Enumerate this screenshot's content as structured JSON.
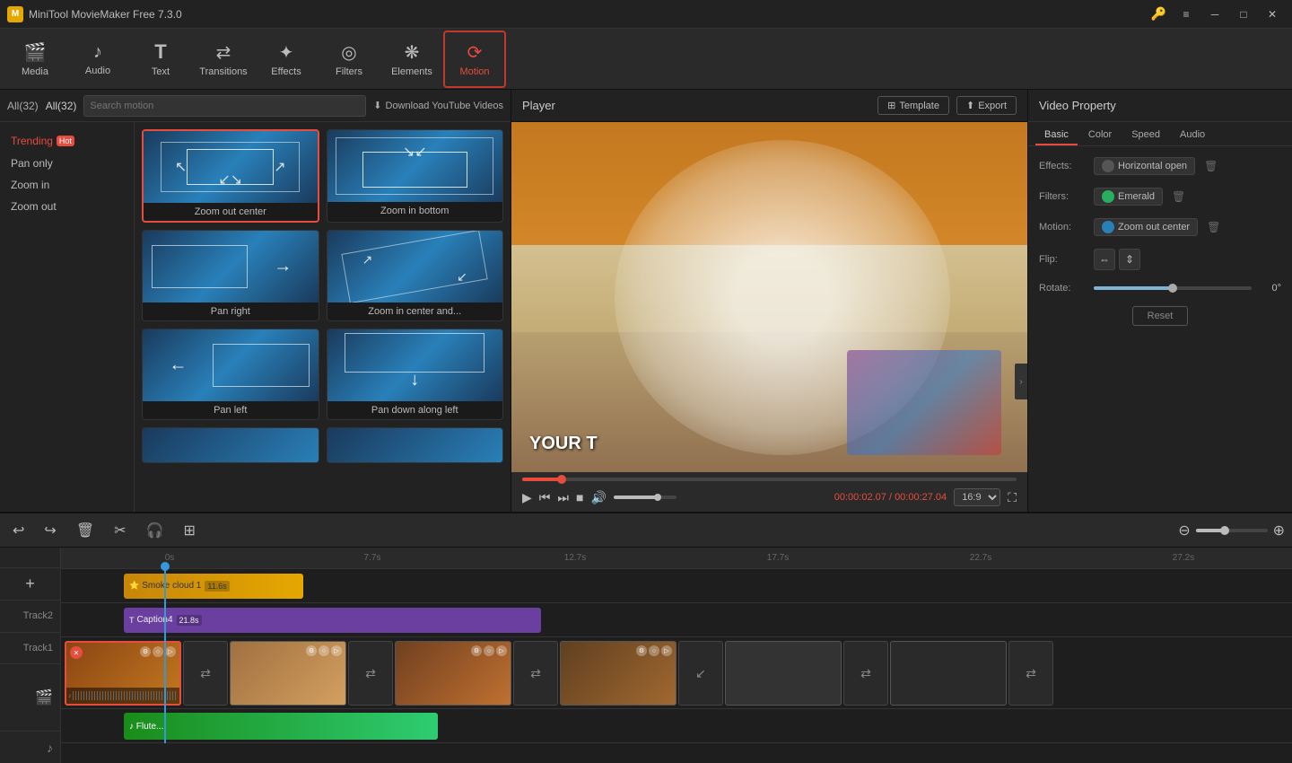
{
  "app": {
    "title": "MiniTool MovieMaker Free 7.3.0",
    "key_icon": "🔑"
  },
  "titlebar": {
    "minimize": "─",
    "maximize": "□",
    "close": "✕",
    "settings_icon": "≡",
    "key_icon": "🔑"
  },
  "toolbar": {
    "items": [
      {
        "id": "media",
        "icon": "🎬",
        "label": "Media",
        "active": false
      },
      {
        "id": "audio",
        "icon": "♪",
        "label": "Audio",
        "active": false
      },
      {
        "id": "text",
        "icon": "T",
        "label": "Text",
        "active": false
      },
      {
        "id": "transitions",
        "icon": "⇄",
        "label": "Transitions",
        "active": false
      },
      {
        "id": "effects",
        "icon": "✦",
        "label": "Effects",
        "active": false
      },
      {
        "id": "filters",
        "icon": "◎",
        "label": "Filters",
        "active": false
      },
      {
        "id": "elements",
        "icon": "❋",
        "label": "Elements",
        "active": false
      },
      {
        "id": "motion",
        "icon": "⟳",
        "label": "Motion",
        "active": true
      }
    ]
  },
  "left_panel": {
    "all_label": "All(32)",
    "search_placeholder": "Search motion",
    "download_label": "Download YouTube Videos",
    "sidebar": {
      "categories": [
        {
          "id": "trending",
          "label": "Trending",
          "hot": true,
          "active": true
        },
        {
          "id": "pan-only",
          "label": "Pan only"
        },
        {
          "id": "zoom-in",
          "label": "Zoom in"
        },
        {
          "id": "zoom-out",
          "label": "Zoom out"
        }
      ]
    },
    "motions": [
      {
        "id": "zoom-out-center",
        "label": "Zoom out center",
        "selected": true
      },
      {
        "id": "zoom-in-bottom",
        "label": "Zoom in bottom",
        "selected": false
      },
      {
        "id": "pan-right",
        "label": "Pan right",
        "selected": false
      },
      {
        "id": "zoom-in-center",
        "label": "Zoom in center and...",
        "selected": false
      },
      {
        "id": "pan-left",
        "label": "Pan left",
        "selected": false
      },
      {
        "id": "pan-down",
        "label": "Pan down along left",
        "selected": false
      }
    ]
  },
  "player": {
    "title": "Player",
    "template_label": "Template",
    "export_label": "Export",
    "time_current": "00:00:02.07",
    "time_total": "00:00:27.04",
    "aspect_ratio": "16:9",
    "video_text": "YOUR T"
  },
  "right_panel": {
    "title": "Video Property",
    "tabs": [
      "Basic",
      "Color",
      "Speed",
      "Audio"
    ],
    "active_tab": "Basic",
    "properties": {
      "effects_label": "Effects:",
      "effects_value": "Horizontal open",
      "filters_label": "Filters:",
      "filters_value": "Emerald",
      "motion_label": "Motion:",
      "motion_value": "Zoom out center",
      "flip_label": "Flip:",
      "rotate_label": "Rotate:",
      "rotate_value": "0°",
      "reset_label": "Reset"
    }
  },
  "timeline": {
    "ruler_marks": [
      "0s",
      "7.7s",
      "12.7s",
      "17.7s",
      "22.7s",
      "27.2s"
    ],
    "tools": {
      "undo": "↩",
      "redo": "↪",
      "delete": "🗑",
      "cut": "✂",
      "audio": "🎧",
      "crop": "⊞"
    },
    "tracks": {
      "track2_label": "Track2",
      "track1_label": "Track1",
      "video_label": "",
      "audio_label": ""
    },
    "clips": {
      "smoke_label": "Smoke cloud 1",
      "smoke_duration": "11.6s",
      "caption_label": "Caption4",
      "caption_duration": "21.8s"
    }
  }
}
